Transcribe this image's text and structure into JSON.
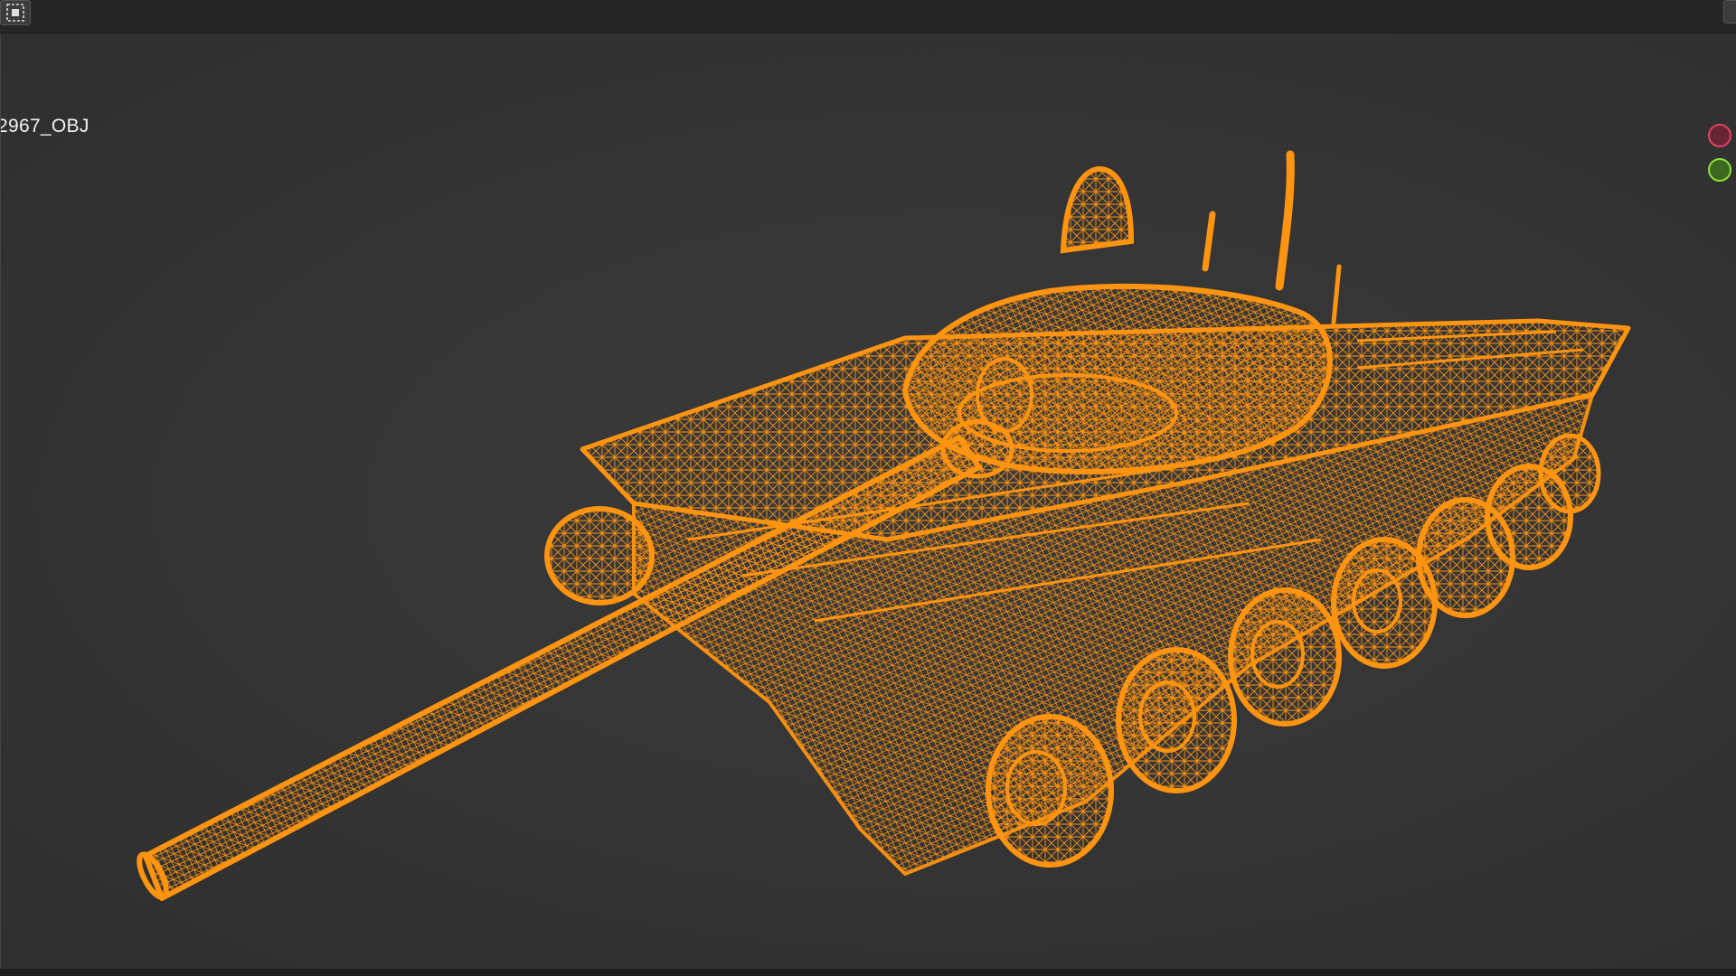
{
  "viewport": {
    "object_name": "2967_OBJ",
    "render_mode": "wireframe",
    "wire_color": "#ff9411",
    "background_color": "#333333"
  },
  "toolbar": {
    "select_icon": "selection-box-icon"
  },
  "gizmo": {
    "x_axis_color": "#e0415f",
    "y_axis_color": "#8ee03a"
  }
}
